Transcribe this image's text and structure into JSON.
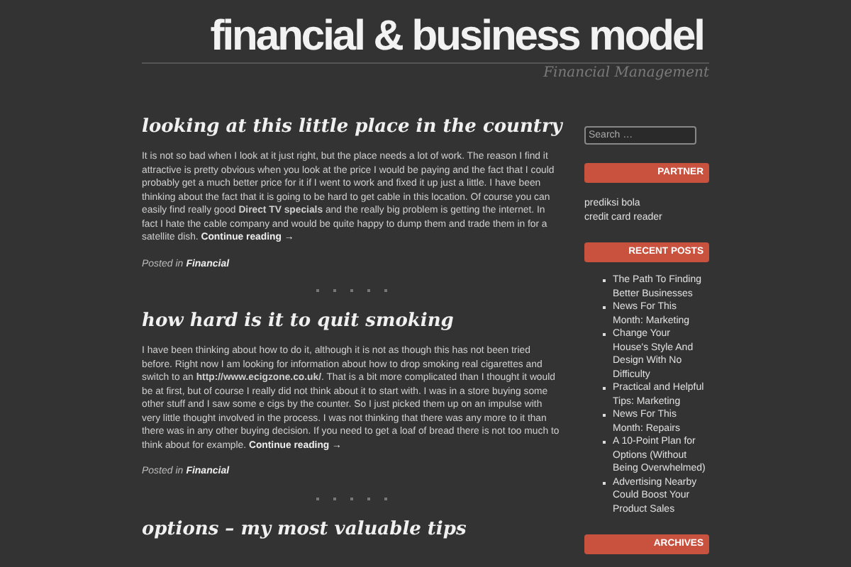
{
  "site": {
    "title": "financial & business model",
    "tagline": "Financial Management"
  },
  "posts": [
    {
      "title": "looking at this little place in the country",
      "body": "It is not so bad when I look at it just right, but the place needs a lot of work. The reason I find it attractive is pretty obvious when you look at the price I would be paying and the fact that I could probably get a much better price for it if I went to work and fixed it up just a little. I have been thinking about the fact that it is going to be hard to get cable in this location. Of course you can easily find really good **Direct TV specials** and the really big problem is getting the internet. In fact I hate the cable company and would be quite happy to dump them and trade them in for a satellite dish.",
      "more": "Continue reading →",
      "posted_label": "Posted in",
      "category": "Financial"
    },
    {
      "title": "how hard is it to quit smoking",
      "body": "I have been thinking about how to do it, although it is not as though this has not been tried before. Right now I am looking for information about how to drop smoking real cigarettes and switch to an **http://www.ecigzone.co.uk/**. That is a bit more complicated than I thought it would be at first, but of course I really did not think about it to start with. I was in a store buying some other stuff and I saw some e cigs by the counter. So I just picked them up on an impulse with very little thought involved in the process. I was not thinking that there was any more to it than there was in any other buying decision. If you need to get a loaf of bread there is not too much to think about for example.",
      "more": "Continue reading →",
      "posted_label": "Posted in",
      "category": "Financial"
    },
    {
      "title": "options – my most valuable tips"
    }
  ],
  "sidebar": {
    "search": {
      "placeholder": "Search …"
    },
    "widgets": [
      {
        "kind": "links",
        "heading": "PARTNER",
        "items": [
          "prediksi bola",
          "credit card reader"
        ]
      },
      {
        "kind": "bullets",
        "heading": "RECENT POSTS",
        "items": [
          "The Path To Finding Better Businesses",
          "News For This Month: Marketing",
          "Change Your House's Style And Design With No Difficulty",
          "Practical and Helpful Tips: Marketing",
          "News For This Month: Repairs",
          "A 10-Point Plan for Options (Without Being Overwhelmed)",
          "Advertising Nearby Could Boost Your Product Sales"
        ]
      },
      {
        "kind": "links",
        "heading": "ARCHIVES"
      }
    ]
  }
}
